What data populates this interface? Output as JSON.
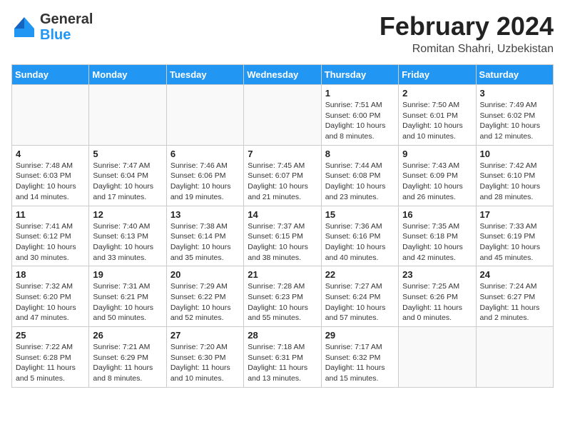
{
  "header": {
    "logo_general": "General",
    "logo_blue": "Blue",
    "cal_title": "February 2024",
    "cal_subtitle": "Romitan Shahri, Uzbekistan"
  },
  "days_of_week": [
    "Sunday",
    "Monday",
    "Tuesday",
    "Wednesday",
    "Thursday",
    "Friday",
    "Saturday"
  ],
  "weeks": [
    [
      {
        "day": "",
        "info": ""
      },
      {
        "day": "",
        "info": ""
      },
      {
        "day": "",
        "info": ""
      },
      {
        "day": "",
        "info": ""
      },
      {
        "day": "1",
        "info": "Sunrise: 7:51 AM\nSunset: 6:00 PM\nDaylight: 10 hours and 8 minutes."
      },
      {
        "day": "2",
        "info": "Sunrise: 7:50 AM\nSunset: 6:01 PM\nDaylight: 10 hours and 10 minutes."
      },
      {
        "day": "3",
        "info": "Sunrise: 7:49 AM\nSunset: 6:02 PM\nDaylight: 10 hours and 12 minutes."
      }
    ],
    [
      {
        "day": "4",
        "info": "Sunrise: 7:48 AM\nSunset: 6:03 PM\nDaylight: 10 hours and 14 minutes."
      },
      {
        "day": "5",
        "info": "Sunrise: 7:47 AM\nSunset: 6:04 PM\nDaylight: 10 hours and 17 minutes."
      },
      {
        "day": "6",
        "info": "Sunrise: 7:46 AM\nSunset: 6:06 PM\nDaylight: 10 hours and 19 minutes."
      },
      {
        "day": "7",
        "info": "Sunrise: 7:45 AM\nSunset: 6:07 PM\nDaylight: 10 hours and 21 minutes."
      },
      {
        "day": "8",
        "info": "Sunrise: 7:44 AM\nSunset: 6:08 PM\nDaylight: 10 hours and 23 minutes."
      },
      {
        "day": "9",
        "info": "Sunrise: 7:43 AM\nSunset: 6:09 PM\nDaylight: 10 hours and 26 minutes."
      },
      {
        "day": "10",
        "info": "Sunrise: 7:42 AM\nSunset: 6:10 PM\nDaylight: 10 hours and 28 minutes."
      }
    ],
    [
      {
        "day": "11",
        "info": "Sunrise: 7:41 AM\nSunset: 6:12 PM\nDaylight: 10 hours and 30 minutes."
      },
      {
        "day": "12",
        "info": "Sunrise: 7:40 AM\nSunset: 6:13 PM\nDaylight: 10 hours and 33 minutes."
      },
      {
        "day": "13",
        "info": "Sunrise: 7:38 AM\nSunset: 6:14 PM\nDaylight: 10 hours and 35 minutes."
      },
      {
        "day": "14",
        "info": "Sunrise: 7:37 AM\nSunset: 6:15 PM\nDaylight: 10 hours and 38 minutes."
      },
      {
        "day": "15",
        "info": "Sunrise: 7:36 AM\nSunset: 6:16 PM\nDaylight: 10 hours and 40 minutes."
      },
      {
        "day": "16",
        "info": "Sunrise: 7:35 AM\nSunset: 6:18 PM\nDaylight: 10 hours and 42 minutes."
      },
      {
        "day": "17",
        "info": "Sunrise: 7:33 AM\nSunset: 6:19 PM\nDaylight: 10 hours and 45 minutes."
      }
    ],
    [
      {
        "day": "18",
        "info": "Sunrise: 7:32 AM\nSunset: 6:20 PM\nDaylight: 10 hours and 47 minutes."
      },
      {
        "day": "19",
        "info": "Sunrise: 7:31 AM\nSunset: 6:21 PM\nDaylight: 10 hours and 50 minutes."
      },
      {
        "day": "20",
        "info": "Sunrise: 7:29 AM\nSunset: 6:22 PM\nDaylight: 10 hours and 52 minutes."
      },
      {
        "day": "21",
        "info": "Sunrise: 7:28 AM\nSunset: 6:23 PM\nDaylight: 10 hours and 55 minutes."
      },
      {
        "day": "22",
        "info": "Sunrise: 7:27 AM\nSunset: 6:24 PM\nDaylight: 10 hours and 57 minutes."
      },
      {
        "day": "23",
        "info": "Sunrise: 7:25 AM\nSunset: 6:26 PM\nDaylight: 11 hours and 0 minutes."
      },
      {
        "day": "24",
        "info": "Sunrise: 7:24 AM\nSunset: 6:27 PM\nDaylight: 11 hours and 2 minutes."
      }
    ],
    [
      {
        "day": "25",
        "info": "Sunrise: 7:22 AM\nSunset: 6:28 PM\nDaylight: 11 hours and 5 minutes."
      },
      {
        "day": "26",
        "info": "Sunrise: 7:21 AM\nSunset: 6:29 PM\nDaylight: 11 hours and 8 minutes."
      },
      {
        "day": "27",
        "info": "Sunrise: 7:20 AM\nSunset: 6:30 PM\nDaylight: 11 hours and 10 minutes."
      },
      {
        "day": "28",
        "info": "Sunrise: 7:18 AM\nSunset: 6:31 PM\nDaylight: 11 hours and 13 minutes."
      },
      {
        "day": "29",
        "info": "Sunrise: 7:17 AM\nSunset: 6:32 PM\nDaylight: 11 hours and 15 minutes."
      },
      {
        "day": "",
        "info": ""
      },
      {
        "day": "",
        "info": ""
      }
    ]
  ]
}
